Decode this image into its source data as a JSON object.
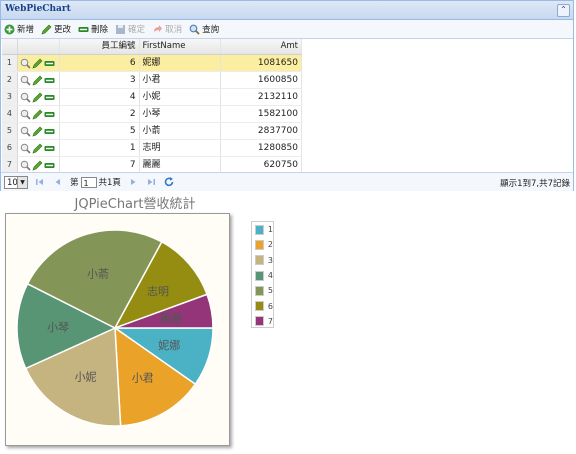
{
  "panel": {
    "title": "WebPieChart"
  },
  "toolbar": {
    "buttons": [
      {
        "label": "新增",
        "icon": "add-icon",
        "enabled": true
      },
      {
        "label": "更改",
        "icon": "edit-icon",
        "enabled": true
      },
      {
        "label": "刪除",
        "icon": "delete-icon",
        "enabled": true
      },
      {
        "label": "確定",
        "icon": "save-icon",
        "enabled": false
      },
      {
        "label": "取消",
        "icon": "cancel-icon",
        "enabled": false
      },
      {
        "label": "查詢",
        "icon": "search-icon",
        "enabled": true
      }
    ]
  },
  "grid": {
    "columns": [
      "",
      "",
      "員工編號",
      "FirstName",
      "Amt"
    ],
    "rows": [
      {
        "n": "1",
        "id": "6",
        "name": "妮娜",
        "amt": "1081650",
        "selected": true
      },
      {
        "n": "2",
        "id": "3",
        "name": "小君",
        "amt": "1600850",
        "selected": false
      },
      {
        "n": "3",
        "id": "4",
        "name": "小妮",
        "amt": "2132110",
        "selected": false
      },
      {
        "n": "4",
        "id": "2",
        "name": "小琴",
        "amt": "1582100",
        "selected": false
      },
      {
        "n": "5",
        "id": "5",
        "name": "小萮",
        "amt": "2837700",
        "selected": false
      },
      {
        "n": "6",
        "id": "1",
        "name": "志明",
        "amt": "1280850",
        "selected": false
      },
      {
        "n": "7",
        "id": "7",
        "name": "麗麗",
        "amt": "620750",
        "selected": false
      }
    ]
  },
  "pager": {
    "page_size": "10",
    "page_prefix": "第",
    "page_value": "1",
    "page_suffix": "共1頁",
    "summary": "顯示1到7,共7記錄"
  },
  "chart_data": {
    "type": "pie",
    "title": "JQPieChart營收統計",
    "slices": [
      {
        "legend": "1",
        "label": "妮娜",
        "value": 1081650,
        "color": "#4bb2c5"
      },
      {
        "legend": "2",
        "label": "小君",
        "value": 1600850,
        "color": "#eaa228"
      },
      {
        "legend": "3",
        "label": "小妮",
        "value": 2132110,
        "color": "#c5b47f"
      },
      {
        "legend": "4",
        "label": "小琴",
        "value": 1582100,
        "color": "#579575"
      },
      {
        "legend": "5",
        "label": "小萮",
        "value": 2837700,
        "color": "#839557"
      },
      {
        "legend": "6",
        "label": "志明",
        "value": 1280850,
        "color": "#958c12"
      },
      {
        "legend": "7",
        "label": "麗麗",
        "value": 620750,
        "color": "#953579"
      }
    ],
    "legend_placement": "right"
  }
}
